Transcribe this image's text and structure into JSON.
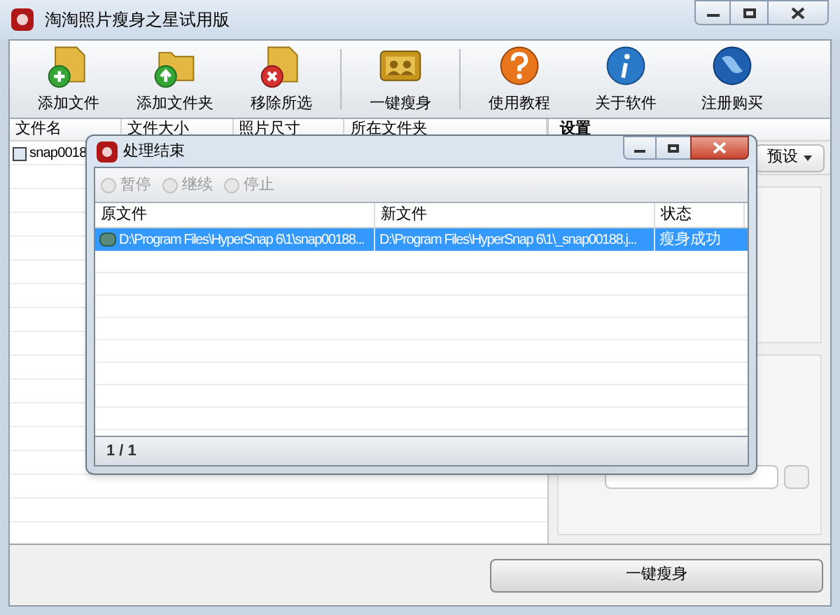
{
  "window": {
    "title": "淘淘照片瘦身之星试用版"
  },
  "toolbar_groups": [
    [
      {
        "label": "添加文件",
        "kind": "add-file"
      },
      {
        "label": "添加文件夹",
        "kind": "add-folder"
      },
      {
        "label": "移除所选",
        "kind": "remove"
      }
    ],
    [
      {
        "label": "一键瘦身",
        "kind": "slim"
      }
    ],
    [
      {
        "label": "使用教程",
        "kind": "help"
      },
      {
        "label": "关于软件",
        "kind": "about"
      },
      {
        "label": "注册购买",
        "kind": "buy"
      }
    ]
  ],
  "file_list": {
    "columns": [
      "文件名",
      "文件大小",
      "照片尺寸",
      "所在文件夹"
    ],
    "rows": [
      {
        "file_name": "snap0018"
      }
    ]
  },
  "settings": {
    "title": "设置",
    "preset_button": "预设"
  },
  "start_button": "一键瘦身",
  "dialog": {
    "title": "处理结束",
    "controls": [
      {
        "label": "暂停",
        "disabled": true
      },
      {
        "label": "继续",
        "disabled": true
      },
      {
        "label": "停止",
        "disabled": true
      }
    ],
    "columns": [
      "原文件",
      "新文件",
      "状态"
    ],
    "rows": [
      {
        "original": "D:\\Program Files\\HyperSnap 6\\1\\snap00188...",
        "new": "D:\\Program Files\\HyperSnap 6\\1\\_snap00188.j...",
        "status": "瘦身成功",
        "selected": true
      }
    ],
    "page": "1 / 1"
  }
}
